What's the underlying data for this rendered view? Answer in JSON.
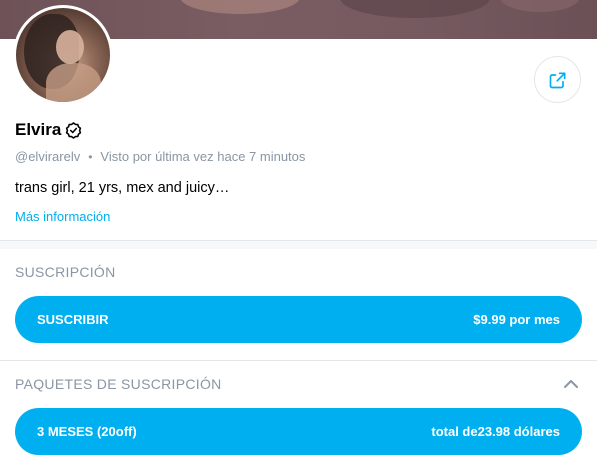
{
  "profile": {
    "name": "Elvira",
    "handle": "@elvirarelv",
    "last_seen": "Visto por última vez hace 7 minutos",
    "bio": "trans girl, 21 yrs, mex and juicy…",
    "more_info": "Más información"
  },
  "subscription": {
    "title": "SUSCRIPCIÓN",
    "button_label": "SUSCRIBIR",
    "price": "$9.99 por mes"
  },
  "bundles": {
    "title": "PAQUETES DE SUSCRIPCIÓN",
    "items": [
      {
        "label": "3 MESES (20off)",
        "price": "total de23.98 dólares"
      }
    ]
  },
  "icons": {
    "share": "share-icon",
    "verified": "verified-badge-icon",
    "collapse": "chevron-up-icon"
  },
  "colors": {
    "accent": "#00aff0",
    "muted_text": "#8a96a3"
  }
}
